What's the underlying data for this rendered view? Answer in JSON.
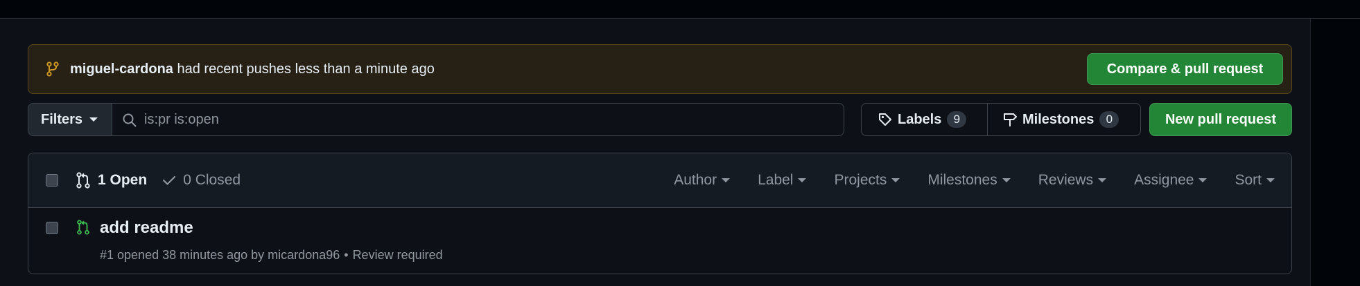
{
  "banner": {
    "user": "miguel-cardona",
    "message": "had recent pushes less than a minute ago",
    "compare_button": "Compare & pull request"
  },
  "filter_bar": {
    "filters_label": "Filters",
    "search_value": "is:pr is:open",
    "labels_label": "Labels",
    "labels_count": "9",
    "milestones_label": "Milestones",
    "milestones_count": "0",
    "new_pr_button": "New pull request"
  },
  "list_header": {
    "open_label": "1 Open",
    "closed_label": "0 Closed",
    "menus": [
      "Author",
      "Label",
      "Projects",
      "Milestones",
      "Reviews",
      "Assignee",
      "Sort"
    ]
  },
  "pull_requests": [
    {
      "title": "add readme",
      "meta": "#1 opened 38 minutes ago by micardona96",
      "status": "Review required"
    }
  ],
  "colors": {
    "accent_green": "#238636",
    "open_icon_green": "#3fb950",
    "banner_icon": "#d29922"
  },
  "icons": {
    "banner": "git-branch-icon",
    "search": "search-icon",
    "labels": "tag-icon",
    "milestones": "milestone-icon",
    "open": "git-pull-request-icon",
    "closed": "check-icon"
  }
}
